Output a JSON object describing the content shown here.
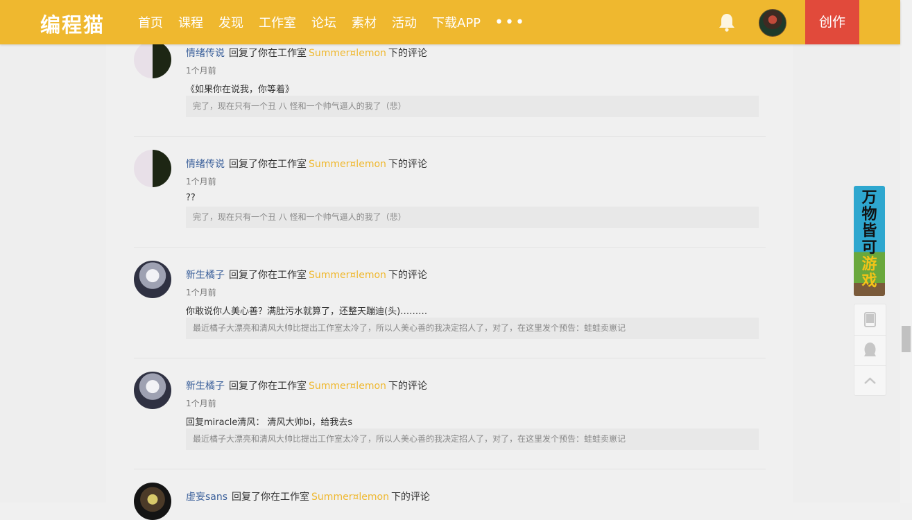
{
  "header": {
    "logo": "编程猫",
    "nav": [
      "首页",
      "课程",
      "发现",
      "工作室",
      "论坛",
      "素材",
      "活动",
      "下载APP"
    ],
    "more": "•••",
    "create_label": "创作"
  },
  "comments": [
    {
      "user": "情绪传说",
      "action": "回复了你在工作室",
      "studio": "Summer¤lemon",
      "suffix": "下的评论",
      "time": "1个月前",
      "body": "《如果你在说我，你等着》",
      "quote": "完了，现在只有一个丑 八 怪和一个帅气逼人的我了（悲）"
    },
    {
      "user": "情绪传说",
      "action": "回复了你在工作室",
      "studio": "Summer¤lemon",
      "suffix": "下的评论",
      "time": "1个月前",
      "body": "??",
      "quote": "完了，现在只有一个丑 八 怪和一个帅气逼人的我了（悲）"
    },
    {
      "user": "新生橘子",
      "action": "回复了你在工作室",
      "studio": "Summer¤lemon",
      "suffix": "下的评论",
      "time": "1个月前",
      "body": "你敢说你人美心善？满肚污水就算了，还整天蹦迪(头)………",
      "quote": "最近橘子大漂亮和清风大帅比提出工作室太冷了，所以人美心善的我决定招人了，对了，在这里发个预告：蛙蛙卖崽记"
    },
    {
      "user": "新生橘子",
      "action": "回复了你在工作室",
      "studio": "Summer¤lemon",
      "suffix": "下的评论",
      "time": "1个月前",
      "body": "回复miracle清风：  清风大帅bi，给我去s",
      "quote": "最近橘子大漂亮和清风大帅比提出工作室太冷了，所以人美心善的我决定招人了，对了，在这里发个预告：蛙蛙卖崽记"
    },
    {
      "user": "虚妄sans",
      "action": "回复了你在工作室",
      "studio": "Summer¤lemon",
      "suffix": "下的评论",
      "time": "",
      "body": "",
      "quote": ""
    }
  ],
  "ad": {
    "line1": "万",
    "line2": "物",
    "line3": "皆",
    "line4": "可",
    "line5": "游",
    "line6": "戏"
  },
  "icons": {
    "bell": "bell-icon",
    "phone": "phone-icon",
    "qq": "qq-icon",
    "top": "back-to-top-icon"
  },
  "colors": {
    "header": "#efb82f",
    "create": "#e14a3b",
    "studio_link": "#efb82f",
    "user_link": "#3a5f9a"
  }
}
